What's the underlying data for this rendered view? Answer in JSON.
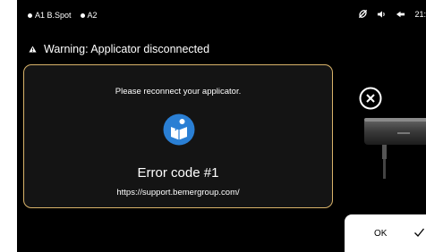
{
  "status_bar": {
    "channels": [
      {
        "label": "A1 B.Spot"
      },
      {
        "label": "A2"
      }
    ],
    "time": "21:",
    "icons": [
      "link-off-icon",
      "volume-icon",
      "bluetooth-icon"
    ]
  },
  "warning": {
    "text": "Warning: Applicator disconnected",
    "icon": "warning-triangle-icon"
  },
  "error_panel": {
    "message": "Please reconnect your applicator.",
    "icon": "read-manual-icon",
    "error_code": "Error code #1",
    "url": "https://support.bemergroup.com/",
    "border_color": "#d9b36a",
    "icon_color": "#2a7fd4"
  },
  "close": {
    "icon": "close-circle-icon"
  },
  "applicator": {
    "image": "applicator-device-image"
  },
  "ok_button": {
    "label": "OK",
    "icon": "check-icon"
  }
}
